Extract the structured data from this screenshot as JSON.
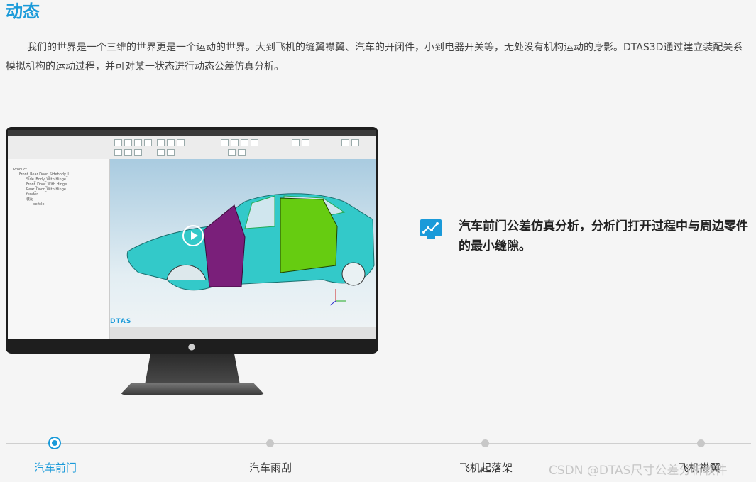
{
  "page": {
    "title": "动态",
    "intro": "我们的世界是一个三维的世界更是一个运动的世界。大到飞机的缝翼襟翼、汽车的开闭件，小到电器开关等，无处没有机构运动的身影。DTAS3D通过建立装配关系模拟机构的运动过程，并可对某一状态进行动态公差仿真分析。"
  },
  "video": {
    "logo_text": "DTAS",
    "play_icon": "play-icon",
    "tree_items": [
      "Product1",
      "Front_Rear Door_Sidebody_I",
      "Side_Body_With Hinge",
      "Front_Door_With Hinge",
      "Rear_Door_With Hinge",
      "fender",
      "装配",
      "seittle"
    ]
  },
  "feature": {
    "icon": "chart-monitor-icon",
    "text": "汽车前门公差仿真分析，分析门打开过程中与周边零件的最小缝隙。"
  },
  "timeline": {
    "items": [
      {
        "label": "汽车前门",
        "active": true
      },
      {
        "label": "汽车雨刮",
        "active": false
      },
      {
        "label": "飞机起落架",
        "active": false
      },
      {
        "label": "飞机襟翼",
        "active": false
      }
    ]
  },
  "watermark": "CSDN @DTAS尺寸公差分析软件",
  "colors": {
    "accent": "#1a9ad9",
    "door": "#7a1f7a",
    "car_body": "#33c9c9",
    "rear_door": "#66cc11"
  }
}
